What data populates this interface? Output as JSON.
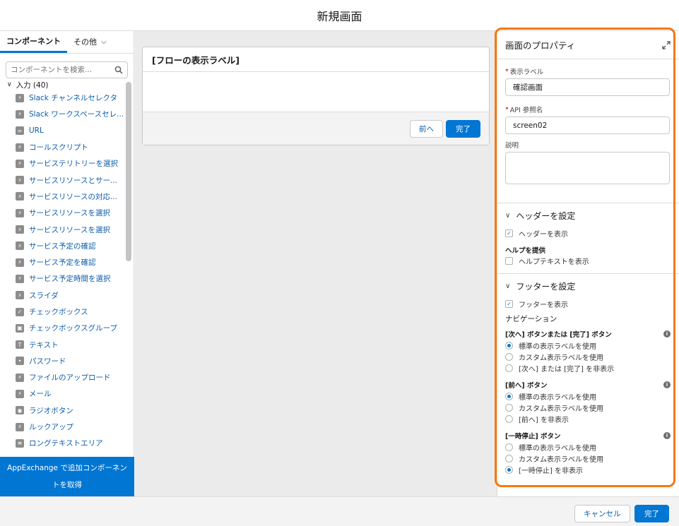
{
  "header": {
    "title": "新規画面"
  },
  "left": {
    "tabs": [
      {
        "label": "コンポーネント"
      },
      {
        "label": "その他"
      }
    ],
    "search_placeholder": "コンポーネントを検索...",
    "section": "入力 (40)",
    "items": [
      {
        "label": "Slack チャンネルセレクタ",
        "icon": "bolt-icon"
      },
      {
        "label": "Slack ワークスペースセレ...",
        "icon": "bolt-icon"
      },
      {
        "label": "URL",
        "icon": "link-icon"
      },
      {
        "label": "コールスクリプト",
        "icon": "bolt-icon"
      },
      {
        "label": "サービステリトリーを選択",
        "icon": "bolt-icon"
      },
      {
        "label": "サービスリソースとサー...",
        "icon": "bolt-icon"
      },
      {
        "label": "サービスリソースの対応...",
        "icon": "bolt-icon"
      },
      {
        "label": "サービスリソースを選択",
        "icon": "bolt-icon"
      },
      {
        "label": "サービスリソースを選択",
        "icon": "bolt-icon"
      },
      {
        "label": "サービス予定の確認",
        "icon": "bolt-icon"
      },
      {
        "label": "サービス予定を確認",
        "icon": "bolt-icon"
      },
      {
        "label": "サービス予定時間を選択",
        "icon": "bolt-icon"
      },
      {
        "label": "スライダ",
        "icon": "bolt-icon"
      },
      {
        "label": "チェックボックス",
        "icon": "checkbox-icon"
      },
      {
        "label": "チェックボックスグループ",
        "icon": "checkbox-group-icon"
      },
      {
        "label": "テキスト",
        "icon": "text-icon"
      },
      {
        "label": "パスワード",
        "icon": "password-icon"
      },
      {
        "label": "ファイルのアップロード",
        "icon": "bolt-icon"
      },
      {
        "label": "メール",
        "icon": "bolt-icon"
      },
      {
        "label": "ラジオボタン",
        "icon": "radio-icon"
      },
      {
        "label": "ルックアップ",
        "icon": "bolt-icon"
      },
      {
        "label": "ロングテキストエリア",
        "icon": "textarea-icon"
      }
    ],
    "appexchange_line1": "AppExchange で追加コンポーネン",
    "appexchange_line2": "トを取得"
  },
  "canvas": {
    "card_title": "[フローの表示ラベル]",
    "prev_label": "前へ",
    "finish_label": "完了"
  },
  "props": {
    "title": "画面のプロパティ",
    "label_field": {
      "label": "表示ラベル",
      "value": "確認画面"
    },
    "api_field": {
      "label": "API 参照名",
      "value": "screen02"
    },
    "desc_label": "説明",
    "header_section": {
      "title": "ヘッダーを設定",
      "show_header": "ヘッダーを表示",
      "help_title": "ヘルプを提供",
      "show_help": "ヘルプテキストを表示"
    },
    "footer_section": {
      "title": "フッターを設定",
      "show_footer": "フッターを表示",
      "nav_title": "ナビゲーション",
      "groups": [
        {
          "title": "[次へ] ボタンまたは [完了] ボタン",
          "options": [
            "標準の表示ラベルを使用",
            "カスタム表示ラベルを使用",
            "[次へ] または [完了] を非表示"
          ],
          "selected": 0
        },
        {
          "title": "[前へ] ボタン",
          "options": [
            "標準の表示ラベルを使用",
            "カスタム表示ラベルを使用",
            "[前へ] を非表示"
          ],
          "selected": 0
        },
        {
          "title": "[一時停止] ボタン",
          "options": [
            "標準の表示ラベルを使用",
            "カスタム表示ラベルを使用",
            "[一時停止] を非表示"
          ],
          "selected": 2
        }
      ]
    }
  },
  "footer": {
    "cancel_label": "キャンセル",
    "done_label": "完了"
  },
  "colors": {
    "brand": "#0176d3",
    "highlight": "#f7780d",
    "link": "#0b5cab"
  }
}
